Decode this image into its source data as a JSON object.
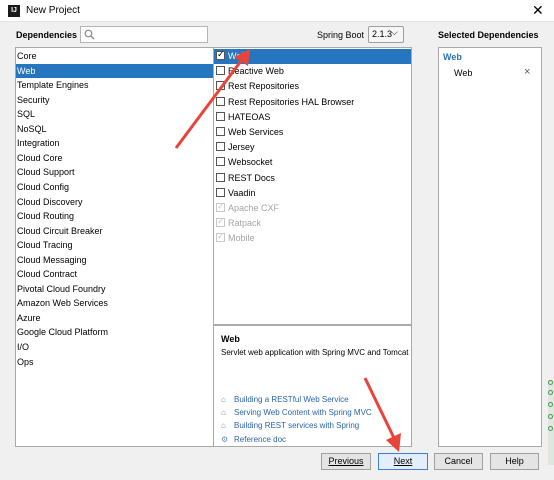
{
  "window": {
    "title": "New Project",
    "app_icon": "IJ",
    "close_glyph": "✕"
  },
  "search": {
    "label": "Dependencies",
    "value": "",
    "placeholder": ""
  },
  "spring_boot": {
    "label": "Spring Boot",
    "version": "2.1.3"
  },
  "categories": [
    "Core",
    "Web",
    "Template Engines",
    "Security",
    "SQL",
    "NoSQL",
    "Integration",
    "Cloud Core",
    "Cloud Support",
    "Cloud Config",
    "Cloud Discovery",
    "Cloud Routing",
    "Cloud Circuit Breaker",
    "Cloud Tracing",
    "Cloud Messaging",
    "Cloud Contract",
    "Pivotal Cloud Foundry",
    "Amazon Web Services",
    "Azure",
    "Google Cloud Platform",
    "I/O",
    "Ops"
  ],
  "selected_category": "Web",
  "dependencies": [
    {
      "label": "Web",
      "checked": true,
      "disabled": false,
      "selected": true
    },
    {
      "label": "Reactive Web",
      "checked": false,
      "disabled": false,
      "selected": false
    },
    {
      "label": "Rest Repositories",
      "checked": false,
      "disabled": false,
      "selected": false
    },
    {
      "label": "Rest Repositories HAL Browser",
      "checked": false,
      "disabled": false,
      "selected": false
    },
    {
      "label": "HATEOAS",
      "checked": false,
      "disabled": false,
      "selected": false
    },
    {
      "label": "Web Services",
      "checked": false,
      "disabled": false,
      "selected": false
    },
    {
      "label": "Jersey",
      "checked": false,
      "disabled": false,
      "selected": false
    },
    {
      "label": "Websocket",
      "checked": false,
      "disabled": false,
      "selected": false
    },
    {
      "label": "REST Docs",
      "checked": false,
      "disabled": false,
      "selected": false
    },
    {
      "label": "Vaadin",
      "checked": false,
      "disabled": false,
      "selected": false
    },
    {
      "label": "Apache CXF",
      "checked": true,
      "disabled": true,
      "selected": false
    },
    {
      "label": "Ratpack",
      "checked": true,
      "disabled": true,
      "selected": false
    },
    {
      "label": "Mobile",
      "checked": true,
      "disabled": true,
      "selected": false
    }
  ],
  "description": {
    "title": "Web",
    "text": "Servlet web application with Spring MVC and Tomcat",
    "guides": [
      {
        "label": "Building a RESTful Web Service",
        "icon": "guide-icon"
      },
      {
        "label": "Serving Web Content with Spring MVC",
        "icon": "guide-icon"
      },
      {
        "label": "Building REST services with Spring",
        "icon": "guide-icon"
      },
      {
        "label": "Reference doc",
        "icon": "reference-icon"
      }
    ]
  },
  "selected_dependencies": {
    "label": "Selected Dependencies",
    "groups": [
      {
        "name": "Web",
        "items": [
          {
            "label": "Web",
            "remove": "×"
          }
        ]
      }
    ]
  },
  "buttons": {
    "previous": "Previous",
    "next": "Next",
    "cancel": "Cancel",
    "help": "Help"
  },
  "colors": {
    "selection": "#2675bf",
    "annotation_arrow": "#e8443a",
    "link": "#2a65a8"
  }
}
